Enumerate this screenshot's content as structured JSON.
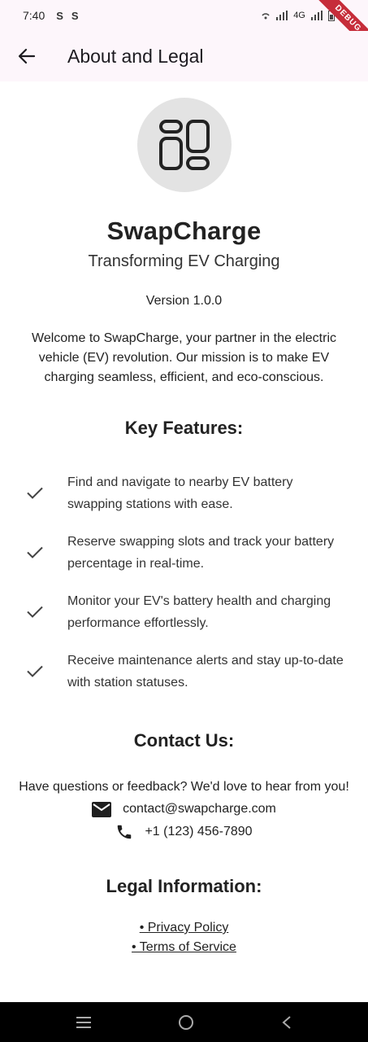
{
  "status_bar": {
    "time": "7:40",
    "network": "4G",
    "battery": "7",
    "debug_label": "DEBUG"
  },
  "app_bar": {
    "title": "About and Legal"
  },
  "app": {
    "name": "SwapCharge",
    "tagline": "Transforming EV Charging",
    "version": "Version 1.0.0",
    "intro": "Welcome to SwapCharge, your partner in the electric vehicle (EV) revolution. Our mission is to make EV charging seamless, efficient, and eco-conscious."
  },
  "features": {
    "title": "Key Features:",
    "items": [
      "Find and navigate to nearby EV battery swapping stations with ease.",
      "Reserve swapping slots and track your battery percentage in real-time.",
      "Monitor your EV's battery health and charging performance effortlessly.",
      "Receive maintenance alerts and stay up-to-date with station statuses."
    ]
  },
  "contact": {
    "title": "Contact Us:",
    "intro": "Have questions or feedback? We'd love to hear from you!",
    "email": "contact@swapcharge.com",
    "phone": "+1 (123) 456-7890"
  },
  "legal": {
    "title": "Legal Information:",
    "privacy": "• Privacy Policy",
    "terms": "• Terms of Service"
  },
  "icons": {
    "back": "arrow-back-icon",
    "logo": "dashboard-grid-icon",
    "check": "check-icon",
    "email": "email-icon",
    "phone": "phone-icon",
    "nav_menu": "menu-icon",
    "nav_home": "home-circle-icon",
    "nav_back": "back-chevron-icon"
  },
  "colors": {
    "app_bar_bg": "#fdf6fb",
    "logo_bg": "#e3e3e3",
    "debug_banner": "#c62d3a",
    "nav_bar_bg": "#000000"
  }
}
